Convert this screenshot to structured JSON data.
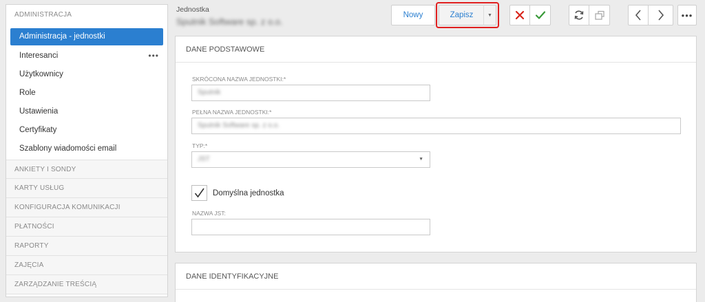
{
  "sidebar": {
    "admin_header": "ADMINISTRACJA",
    "items": [
      {
        "label": "Administracja - jednostki"
      },
      {
        "label": "Interesanci"
      },
      {
        "label": "Użytkownicy"
      },
      {
        "label": "Role"
      },
      {
        "label": "Ustawienia"
      },
      {
        "label": "Certyfikaty"
      },
      {
        "label": "Szablony wiadomości email"
      }
    ],
    "more_glyph": "•••",
    "sections": [
      {
        "label": "ANKIETY I SONDY"
      },
      {
        "label": "KARTY USŁUG"
      },
      {
        "label": "KONFIGURACJA KOMUNIKACJI"
      },
      {
        "label": "PŁATNOŚCI"
      },
      {
        "label": "RAPORTY"
      },
      {
        "label": "ZAJĘCIA"
      },
      {
        "label": "ZARZĄDZANIE TREŚCIĄ"
      }
    ]
  },
  "header": {
    "record_type": "Jednostka",
    "record_name": "Sputnik Software sp. z o.o."
  },
  "toolbar": {
    "new_label": "Nowy",
    "save_label": "Zapisz",
    "dropdown_glyph": "▼",
    "more_glyph": "•••",
    "cancel_color": "#d9261c",
    "accept_color": "#3a9a3a"
  },
  "form": {
    "section_basic": "DANE PODSTAWOWE",
    "short_name_label": "SKRÓCONA NAZWA JEDNOSTKI:*",
    "short_name_value": "Sputnik",
    "full_name_label": "PEŁNA NAZWA JEDNOSTKI:*",
    "full_name_value": "Sputnik Software sp. z o.o.",
    "type_label": "TYP:*",
    "type_value": "JST",
    "select_arrow": "▼",
    "default_unit_label": "Domyślna jednostka",
    "default_unit_checked": true,
    "jst_name_label": "NAZWA JST:",
    "jst_name_value": "",
    "section_ident": "DANE IDENTYFIKACYJNE"
  }
}
